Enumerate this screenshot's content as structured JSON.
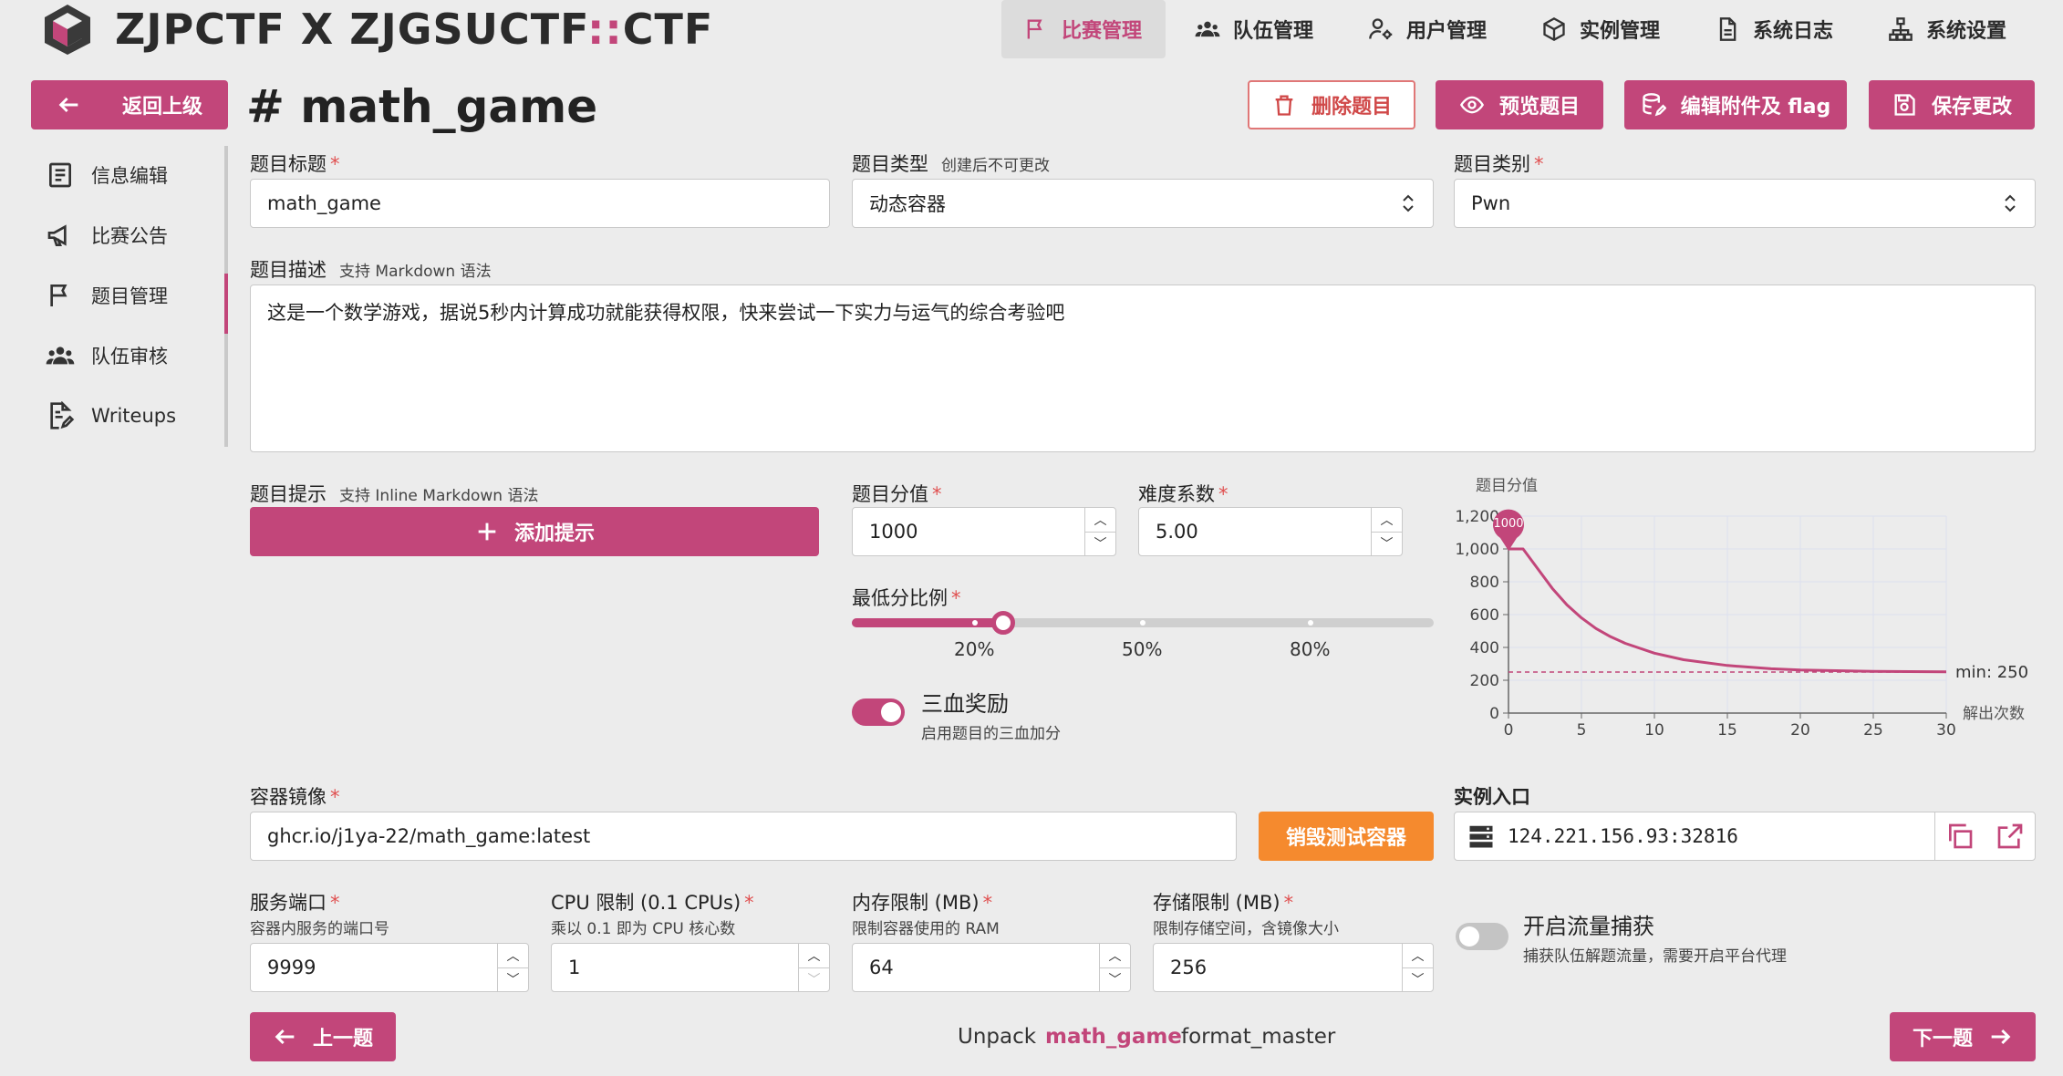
{
  "header": {
    "app_title_left": "ZJPCTF X ZJGSUCTF",
    "app_title_sep": "::",
    "app_title_right": "CTF",
    "nav": [
      {
        "label": "比赛管理",
        "icon": "flag-icon",
        "active": true
      },
      {
        "label": "队伍管理",
        "icon": "users-icon",
        "active": false
      },
      {
        "label": "用户管理",
        "icon": "user-gear-icon",
        "active": false
      },
      {
        "label": "实例管理",
        "icon": "cube-icon",
        "active": false
      },
      {
        "label": "系统日志",
        "icon": "file-log-icon",
        "active": false
      },
      {
        "label": "系统设置",
        "icon": "hierarchy-icon",
        "active": false
      }
    ]
  },
  "toolbar": {
    "back_label": "返回上级",
    "page_title": "# math_game",
    "delete_label": "删除题目",
    "preview_label": "预览题目",
    "edit_attachment_label": "编辑附件及 flag",
    "save_label": "保存更改"
  },
  "sidebar": {
    "items": [
      {
        "label": "信息编辑",
        "icon": "file-text-icon"
      },
      {
        "label": "比赛公告",
        "icon": "speaker-icon"
      },
      {
        "label": "题目管理",
        "icon": "flag-icon"
      },
      {
        "label": "队伍审核",
        "icon": "users-icon"
      },
      {
        "label": "Writeups",
        "icon": "file-edit-icon"
      }
    ],
    "active_index": 2
  },
  "form": {
    "title_label": "题目标题",
    "title_value": "math_game",
    "type_label": "题目类型",
    "type_hint": "创建后不可更改",
    "type_value": "动态容器",
    "category_label": "题目类别",
    "category_value": "Pwn",
    "desc_label": "题目描述",
    "desc_hint": "支持 Markdown 语法",
    "desc_value": "这是一个数学游戏，据说5秒内计算成功就能获得权限，快来尝试一下实力与运气的综合考验吧",
    "hint_label": "题目提示",
    "hint_hint": "支持 Inline Markdown 语法",
    "add_hint_label": "添加提示",
    "score_label": "题目分值",
    "score_value": "1000",
    "difficulty_label": "难度系数",
    "difficulty_value": "5.00",
    "min_ratio_label": "最低分比例",
    "min_ratio_value": 0.25,
    "slider_marks": [
      "20%",
      "50%",
      "80%"
    ],
    "blood_title": "三血奖励",
    "blood_desc": "启用题目的三血加分",
    "blood_enabled": true,
    "image_label": "容器镜像",
    "image_value": "ghcr.io/j1ya-22/math_game:latest",
    "destroy_label": "销毁测试容器",
    "entry_label": "实例入口",
    "entry_value": "124.221.156.93:32816",
    "port_label": "服务端口",
    "port_desc": "容器内服务的端口号",
    "port_value": "9999",
    "cpu_label": "CPU 限制 (0.1 CPUs)",
    "cpu_desc": "乘以 0.1 即为 CPU 核心数",
    "cpu_value": "1",
    "mem_label": "内存限制 (MB)",
    "mem_desc": "限制容器使用的 RAM",
    "mem_value": "64",
    "storage_label": "存储限制 (MB)",
    "storage_desc": "限制存储空间，含镜像大小",
    "storage_value": "256",
    "capture_title": "开启流量捕获",
    "capture_desc": "捕获队伍解题流量，需要开启平台代理",
    "capture_enabled": false,
    "required_mark": "*"
  },
  "footer": {
    "prev_label": "上一题",
    "next_label": "下一题",
    "prev_name": "Unpack",
    "current_name": "math_game",
    "next_name": "format_master"
  },
  "chart_data": {
    "type": "line",
    "ylabel": "题目分值",
    "xlabel": "解出次数",
    "x_ticks": [
      0,
      5,
      10,
      15,
      20,
      25,
      30
    ],
    "y_ticks": [
      "0",
      "200",
      "400",
      "600",
      "800",
      "1,000",
      "1,200"
    ],
    "xlim": [
      0,
      30
    ],
    "ylim": [
      0,
      1200
    ],
    "x": [
      0,
      1,
      2,
      3,
      4,
      5,
      6,
      7,
      8,
      10,
      12,
      15,
      18,
      20,
      25,
      30
    ],
    "y": [
      1000,
      1000,
      880,
      760,
      660,
      580,
      515,
      465,
      425,
      365,
      325,
      290,
      270,
      262,
      254,
      251
    ],
    "peak_label": "1000",
    "min_value": 250,
    "min_label": "min: 250",
    "color": "#c2467a"
  },
  "colors": {
    "accent": "#c2467a",
    "danger": "#d04848",
    "orange": "#f58a2e"
  }
}
